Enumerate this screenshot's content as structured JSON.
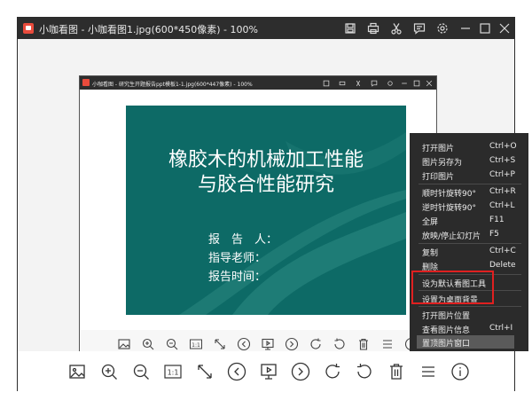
{
  "window": {
    "title": "小咖看图 - 小咖看图1.jpg(600*450像素) - 100%"
  },
  "inner_window": {
    "title": "小咖看图 - 研究生开题报告ppt模板1-1.jpg(600*447像素) - 100%"
  },
  "slide": {
    "title_line1": "橡胶木的机械加工性能",
    "title_line2": "与胶合性能研究",
    "field1": "报　告　人：",
    "field2": "指导老师：",
    "field3": "报告时间："
  },
  "title_icons": [
    "save-icon",
    "print-icon",
    "cut-icon",
    "comment-icon",
    "settings-icon",
    "minimize-icon",
    "maximize-icon",
    "close-icon"
  ],
  "toolbar_icons": [
    "image-icon",
    "zoom-in-icon",
    "zoom-out-icon",
    "actual-size-icon",
    "fit-window-icon",
    "previous-icon",
    "slideshow-icon",
    "next-icon",
    "rotate-clockwise-icon",
    "rotate-counterclockwise-icon",
    "delete-icon",
    "menu-icon",
    "info-icon"
  ],
  "actual_size_label": "1:1",
  "context_menu": {
    "items": [
      {
        "label": "打开图片",
        "shortcut": "Ctrl+O"
      },
      {
        "label": "图片另存为",
        "shortcut": "Ctrl+S"
      },
      {
        "label": "打印图片",
        "shortcut": "Ctrl+P"
      },
      {
        "label": "顺时针旋转90°",
        "shortcut": "Ctrl+R"
      },
      {
        "label": "逆时针旋转90°",
        "shortcut": "Ctrl+L"
      },
      {
        "label": "全屏",
        "shortcut": "F11"
      },
      {
        "label": "放映/停止幻灯片",
        "shortcut": "F5"
      },
      {
        "label": "复制",
        "shortcut": "Ctrl+C"
      },
      {
        "label": "删除",
        "shortcut": "Delete"
      },
      {
        "label": "设为默认看图工具",
        "shortcut": ""
      },
      {
        "label": "设置为桌面背景",
        "shortcut": ""
      },
      {
        "label": "打开图片位置",
        "shortcut": ""
      },
      {
        "label": "查看图片信息",
        "shortcut": "Ctrl+I"
      },
      {
        "label": "置顶图片窗口",
        "shortcut": ""
      }
    ]
  },
  "colors": {
    "titlebar": "#2d2d2d",
    "slide_background": "#0d6a66",
    "menu_background": "#2b2b2b",
    "highlight_box": "#e02020"
  }
}
